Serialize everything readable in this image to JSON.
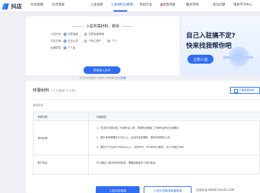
{
  "brand": {
    "name": "抖店"
  },
  "nav": [
    {
      "label": "抖音旗舰",
      "active": false
    },
    {
      "label": "抖音电商",
      "active": false
    },
    {
      "label": "入驻指南",
      "active": false
    },
    {
      "label": "入驻材料与费用",
      "active": true
    },
    {
      "label": "热招行业",
      "active": false
    },
    {
      "label": "禁售商家",
      "active": false
    },
    {
      "label": "服务市场",
      "active": false
    },
    {
      "label": "常见问题",
      "active": false
    },
    {
      "label": "电商学习中心",
      "active": false
    }
  ],
  "panel": {
    "title": "入驻所需材料、费用",
    "rows": [
      {
        "label": "入驻方向",
        "options": [
          {
            "label": "抖音电商",
            "on": true
          },
          {
            "label": "抖音电商商城",
            "on": false
          }
        ]
      },
      {
        "label": "开店主体",
        "options": [
          {
            "label": "企业公司",
            "on": true
          },
          {
            "label": "个体工商户",
            "on": false
          },
          {
            "label": "个人",
            "on": false
          }
        ]
      },
      {
        "label": "店铺类型",
        "options": [
          {
            "label": "个人店",
            "on": true
          }
        ]
      }
    ],
    "generate_button": "获得准入条件",
    "hint": "查不到对应需求？我们可以帮你解决疑惑",
    "hint_link": "查看"
  },
  "banner": {
    "line1": "自己入驻搞不定?",
    "line2": "快来找我帮你吧",
    "button": "立即入驻"
  },
  "materials": {
    "title": "所需材料",
    "subtitle": "(个人身份-个人店)",
    "download_button": "下载所需材料",
    "section_label": "基础资质",
    "columns": [
      "资质列表",
      "详细描述"
    ],
    "rows": [
      {
        "name": "身份证明",
        "details": [
          "1、仅支持中国大陆二代身份证入驻，须提供经营者二代身份证的正反面照片",
          "2、图片有效期需在30天以上，且证件信息清晰，请在有效期内上传",
          "3、图片尺寸为800*800px以上，支持PNG、JPG和JPEG格式，大小不超过5MB"
        ]
      },
      {
        "name": "账户验证",
        "details": [
          "可以通过人脸识别完成验证，需要经营者本人进行验证"
        ]
      }
    ],
    "primary_button": "入驻抖音电商",
    "secondary_button": "入驻抖音精选联盟电商"
  },
  "watermark": "百度知道 WWW.50LHD.COM"
}
